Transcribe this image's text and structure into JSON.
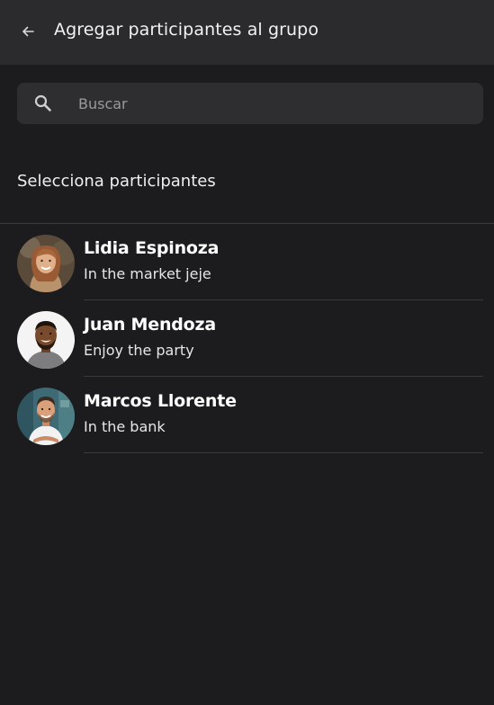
{
  "header": {
    "title": "Agregar participantes al grupo",
    "back_icon": "arrow-left-icon"
  },
  "search": {
    "placeholder": "Buscar",
    "icon": "search-icon"
  },
  "section": {
    "title": "Selecciona participantes"
  },
  "contacts": [
    {
      "name": "Lidia Espinoza",
      "status": "In the market jeje"
    },
    {
      "name": "Juan Mendoza",
      "status": "Enjoy the party"
    },
    {
      "name": "Marcos Llorente",
      "status": "In the bank"
    }
  ],
  "colors": {
    "background": "#1c1c1e",
    "header": "#2b2b2d",
    "search": "#2e2e30",
    "divider": "#3a3a3c"
  }
}
